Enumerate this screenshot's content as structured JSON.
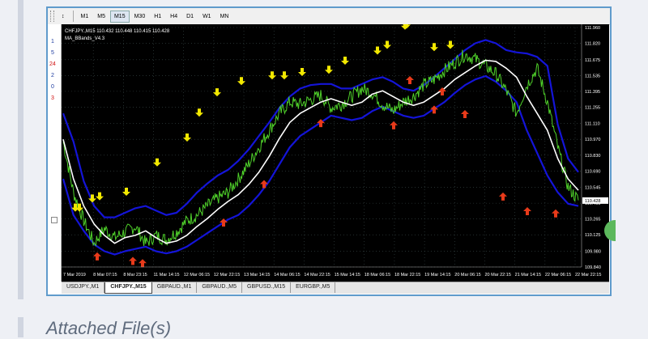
{
  "toolbar": {
    "items": [
      "M1",
      "M5",
      "M15",
      "M30",
      "H1",
      "H4",
      "D1",
      "W1",
      "MN"
    ],
    "active": "M15"
  },
  "sidebar": {
    "numbers": [
      {
        "label": "1",
        "color": "#1e3ca0"
      },
      {
        "label": "5",
        "color": "#1e3ca0"
      },
      {
        "label": "24",
        "color": "#d01010"
      },
      {
        "label": "2",
        "color": "#1e3ca0"
      },
      {
        "label": "0",
        "color": "#1e3ca0"
      },
      {
        "label": "3",
        "color": "#d01010"
      }
    ]
  },
  "chart": {
    "header_line1": "CHFJPY.,M15  110.432 110.448 110.415 110.428",
    "header_line2": "MA_BBands_V4.3",
    "current_price": "110.428",
    "price_levels": [
      "111.960",
      "111.820",
      "111.675",
      "111.535",
      "111.395",
      "111.255",
      "111.110",
      "110.970",
      "110.830",
      "110.690",
      "110.545",
      "110.405",
      "110.265",
      "110.125",
      "109.980",
      "109.840"
    ],
    "date_labels": [
      "7 Mar 2019",
      "8 Mar 07:15",
      "8 Mar 23:15",
      "11 Mar 14:15",
      "12 Mar 06:15",
      "12 Mar 22:15",
      "13 Mar 14:15",
      "14 Mar 06:15",
      "14 Mar 22:15",
      "15 Mar 14:15",
      "18 Mar 06:15",
      "18 Mar 22:15",
      "19 Mar 14:15",
      "20 Mar 06:15",
      "20 Mar 22:15",
      "21 Mar 14:15",
      "22 Mar 06:15",
      "22 Mar 22:15"
    ],
    "colors": {
      "background": "#000000",
      "price": "#4fd12a",
      "bands": "#1414d8",
      "ma": "#ffffff",
      "sell_arrow": "#f2e800",
      "buy_arrow": "#e83a1a",
      "grid": "#3a4a4a"
    },
    "ma_values": [
      110.97,
      110.62,
      110.38,
      110.22,
      110.12,
      110.05,
      110.1,
      110.12,
      110.16,
      110.1,
      110.05,
      110.07,
      110.12,
      110.2,
      110.27,
      110.35,
      110.42,
      110.48,
      110.57,
      110.68,
      110.82,
      110.98,
      111.12,
      111.2,
      111.25,
      111.3,
      111.33,
      111.3,
      111.27,
      111.3,
      111.37,
      111.4,
      111.35,
      111.3,
      111.27,
      111.3,
      111.36,
      111.42,
      111.5,
      111.56,
      111.62,
      111.67,
      111.66,
      111.6,
      111.52,
      111.35,
      111.2,
      111.05,
      110.8,
      110.62,
      110.52
    ],
    "upper_band": [
      111.2,
      110.95,
      110.6,
      110.38,
      110.28,
      110.28,
      110.32,
      110.36,
      110.38,
      110.34,
      110.3,
      110.32,
      110.4,
      110.5,
      110.58,
      110.65,
      110.7,
      110.78,
      110.88,
      111.0,
      111.12,
      111.25,
      111.35,
      111.42,
      111.45,
      111.46,
      111.46,
      111.42,
      111.42,
      111.46,
      111.5,
      111.52,
      111.48,
      111.42,
      111.4,
      111.45,
      111.52,
      111.6,
      111.68,
      111.76,
      111.82,
      111.85,
      111.82,
      111.76,
      111.74,
      111.73,
      111.7,
      111.62,
      111.1,
      110.8,
      110.68
    ],
    "lower_band": [
      110.62,
      110.3,
      110.16,
      110.04,
      109.98,
      109.95,
      109.98,
      110.0,
      110.02,
      109.98,
      109.96,
      109.98,
      110.02,
      110.08,
      110.14,
      110.2,
      110.26,
      110.3,
      110.38,
      110.48,
      110.6,
      110.75,
      110.9,
      111.0,
      111.06,
      111.12,
      111.18,
      111.16,
      111.14,
      111.16,
      111.22,
      111.26,
      111.22,
      111.18,
      111.16,
      111.18,
      111.24,
      111.3,
      111.38,
      111.45,
      111.5,
      111.53,
      111.48,
      111.4,
      111.3,
      111.05,
      110.85,
      110.65,
      110.5,
      110.4,
      110.38
    ],
    "price_values": [
      110.95,
      110.5,
      110.25,
      110.05,
      110.18,
      110.1,
      110.15,
      110.2,
      110.05,
      110.12,
      110.08,
      110.15,
      110.25,
      110.3,
      110.38,
      110.45,
      110.5,
      110.62,
      110.75,
      110.9,
      111.05,
      111.2,
      111.3,
      111.28,
      111.32,
      111.36,
      111.25,
      111.28,
      111.35,
      111.42,
      111.38,
      111.28,
      111.22,
      111.3,
      111.35,
      111.45,
      111.5,
      111.58,
      111.65,
      111.72,
      111.68,
      111.62,
      111.55,
      111.4,
      111.2,
      111.45,
      111.6,
      111.3,
      110.9,
      110.55,
      110.43
    ],
    "sell_arrows": [
      [
        17,
        110.28
      ],
      [
        22,
        110.28
      ],
      [
        38,
        110.36
      ],
      [
        47,
        110.38
      ],
      [
        80,
        110.42
      ],
      [
        118,
        110.68
      ],
      [
        155,
        110.9
      ],
      [
        170,
        111.12
      ],
      [
        192,
        111.3
      ],
      [
        222,
        111.4
      ],
      [
        260,
        111.45
      ],
      [
        275,
        111.45
      ],
      [
        297,
        111.48
      ],
      [
        330,
        111.5
      ],
      [
        350,
        111.58
      ],
      [
        390,
        111.67
      ],
      [
        402,
        111.72
      ],
      [
        424,
        111.89
      ],
      [
        426,
        111.9
      ],
      [
        460,
        111.7
      ],
      [
        480,
        111.72
      ]
    ],
    "buy_arrows": [
      [
        44,
        110.02
      ],
      [
        88,
        109.98
      ],
      [
        100,
        109.96
      ],
      [
        200,
        110.32
      ],
      [
        250,
        110.66
      ],
      [
        320,
        111.2
      ],
      [
        410,
        111.18
      ],
      [
        460,
        111.32
      ],
      [
        430,
        111.58
      ],
      [
        470,
        111.48
      ],
      [
        498,
        111.28
      ],
      [
        545,
        110.55
      ],
      [
        575,
        110.42
      ],
      [
        610,
        110.4
      ]
    ]
  },
  "tabs": [
    "USDJPY.,M1",
    "CHFJPY.,M15",
    "GBPAUD.,M1",
    "GBPAUD.,M5",
    "GBPUSD.,M15",
    "EURGBP.,M5"
  ],
  "active_tab": "CHFJPY.,M15",
  "attached_label": "Attached File(s)"
}
